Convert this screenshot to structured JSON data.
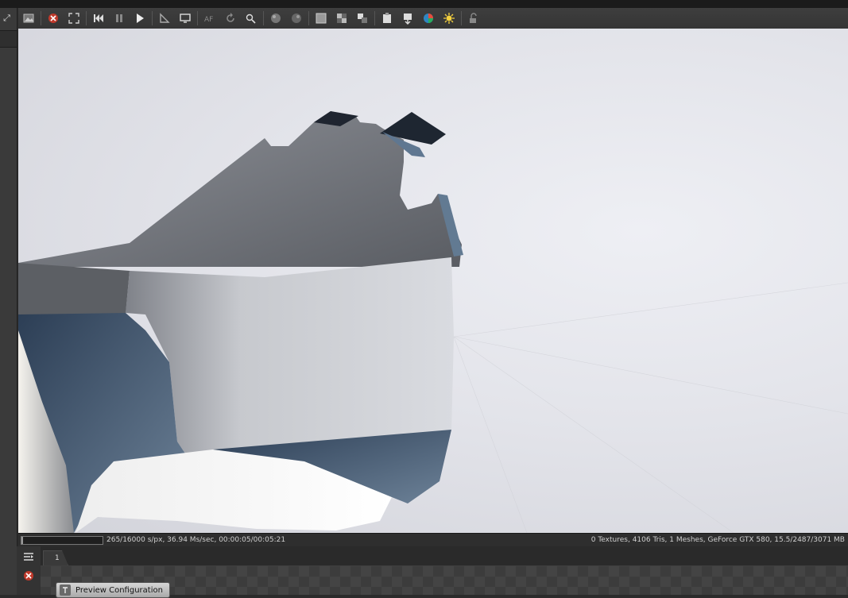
{
  "window": {
    "expand_glyph": "⤢"
  },
  "toolbar": {
    "buttons": [
      {
        "name": "image-icon"
      },
      {
        "sep": true
      },
      {
        "name": "cancel-render-icon"
      },
      {
        "name": "fit-region-icon"
      },
      {
        "sep": true
      },
      {
        "name": "restart-icon"
      },
      {
        "name": "pause-icon"
      },
      {
        "name": "play-icon"
      },
      {
        "sep": true
      },
      {
        "name": "measure-icon"
      },
      {
        "name": "display-icon"
      },
      {
        "sep": true
      },
      {
        "name": "af-icon"
      },
      {
        "name": "refresh-icon"
      },
      {
        "name": "pick-icon"
      },
      {
        "sep": true
      },
      {
        "name": "sphere-icon"
      },
      {
        "name": "sphere-alt-icon"
      },
      {
        "sep": true
      },
      {
        "name": "grid-icon"
      },
      {
        "name": "checker-icon"
      },
      {
        "name": "compare-icon"
      },
      {
        "sep": true
      },
      {
        "name": "clipboard-icon"
      },
      {
        "name": "export-icon"
      },
      {
        "name": "color-icon"
      },
      {
        "name": "light-icon"
      },
      {
        "sep": true
      },
      {
        "name": "lock-icon"
      }
    ]
  },
  "status": {
    "progress": 0.0166,
    "left_text": "265/16000 s/px, 36.94 Ms/sec, 00:00:05/00:05:21",
    "right_text": "0 Textures, 4106 Tris, 1 Meshes, GeForce GTX 580, 15.5/2487/3071 MB"
  },
  "graph": {
    "tab_label": "1",
    "node_label": "Preview Configuration"
  },
  "colors": {
    "accent": "#c0392b",
    "viewport_bg": "#e3e4ea"
  }
}
